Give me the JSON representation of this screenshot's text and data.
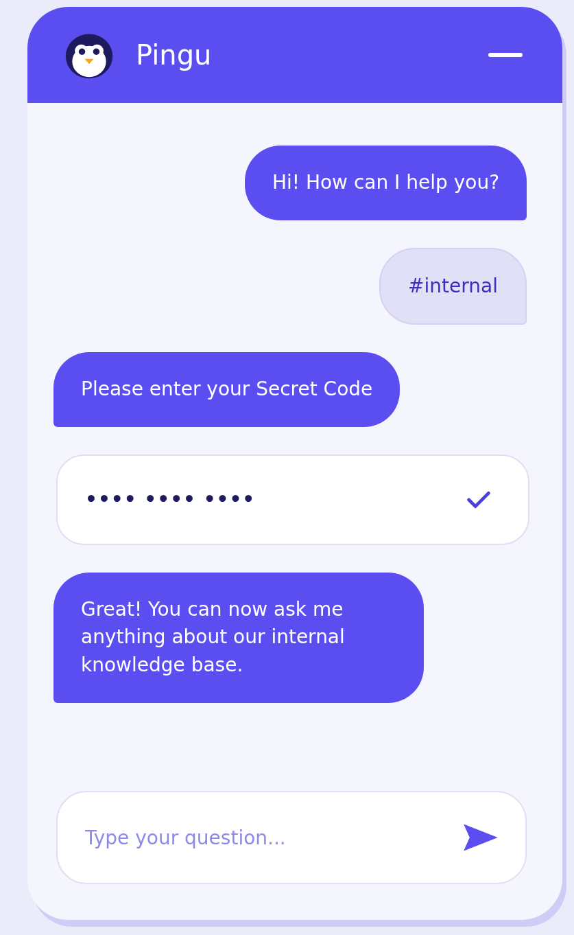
{
  "header": {
    "title": "Pingu"
  },
  "messages": [
    {
      "kind": "sent",
      "text": "Hi! How can I help you?"
    },
    {
      "kind": "tag",
      "text": "#internal"
    },
    {
      "kind": "received",
      "text": "Please enter your Secret Code"
    },
    {
      "kind": "code",
      "value": "•••• •••• ••••",
      "verified": true
    },
    {
      "kind": "received",
      "text": "Great! You can now ask me anything about our internal knowledge base."
    }
  ],
  "composer": {
    "placeholder": "Type your question..."
  }
}
